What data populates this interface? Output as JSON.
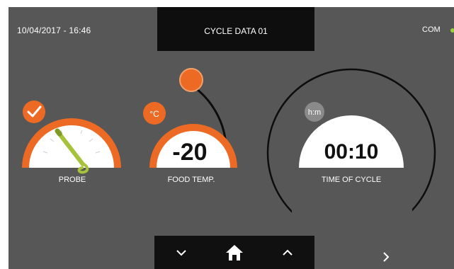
{
  "header": {
    "datetime": "10/04/2017 - 16:46",
    "title": "CYCLE DATA 01",
    "com_label": "COM",
    "com_status_color": "#9ed040"
  },
  "gauges": {
    "probe": {
      "label": "PROBE",
      "status_icon": "check-icon",
      "icon": "probe-icon"
    },
    "food_temp": {
      "label": "FOOD TEMP.",
      "unit": "°C",
      "value": "-20"
    },
    "time_of_cycle": {
      "label": "TIME OF CYCLE",
      "unit": "h:m",
      "value": "00:10"
    }
  },
  "nav": {
    "down_icon": "chevron-down-icon",
    "home_icon": "home-icon",
    "up_icon": "chevron-up-icon",
    "next_icon": "chevron-right-icon"
  },
  "colors": {
    "accent": "#ec6a24",
    "background": "#575757",
    "bar": "#101010",
    "probe_green": "#a6c23a"
  }
}
